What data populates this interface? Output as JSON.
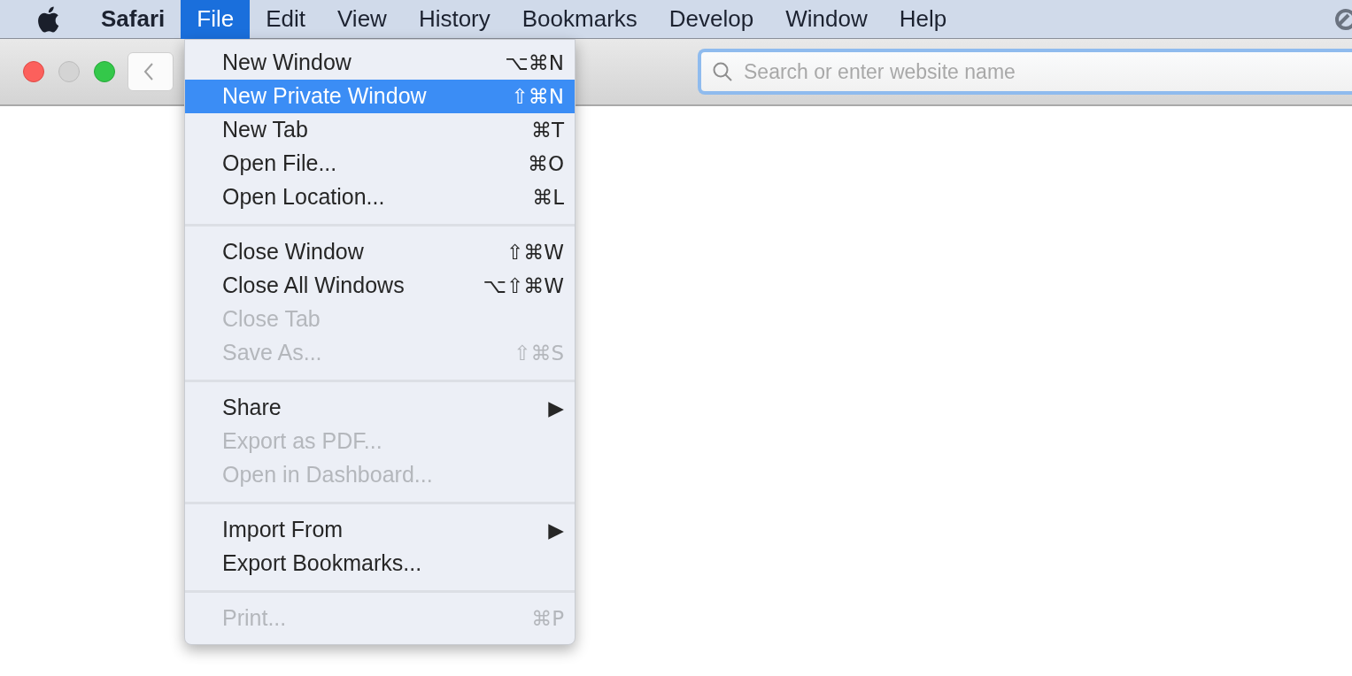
{
  "menu_bar": {
    "items": [
      {
        "label": "Safari",
        "kind": "app",
        "selected": false
      },
      {
        "label": "File",
        "kind": "menu",
        "selected": true
      },
      {
        "label": "Edit",
        "kind": "menu",
        "selected": false
      },
      {
        "label": "View",
        "kind": "menu",
        "selected": false
      },
      {
        "label": "History",
        "kind": "menu",
        "selected": false
      },
      {
        "label": "Bookmarks",
        "kind": "menu",
        "selected": false
      },
      {
        "label": "Develop",
        "kind": "menu",
        "selected": false
      },
      {
        "label": "Window",
        "kind": "menu",
        "selected": false
      },
      {
        "label": "Help",
        "kind": "menu",
        "selected": false
      }
    ]
  },
  "toolbar": {
    "search": {
      "placeholder": "Search or enter website name"
    }
  },
  "file_menu": {
    "items": [
      {
        "kind": "item",
        "label": "New Window",
        "shortcut": "⌥⌘N",
        "disabled": false,
        "selected": false
      },
      {
        "kind": "item",
        "label": "New Private Window",
        "shortcut": "⇧⌘N",
        "disabled": false,
        "selected": true
      },
      {
        "kind": "item",
        "label": "New Tab",
        "shortcut": "⌘T",
        "disabled": false,
        "selected": false
      },
      {
        "kind": "item",
        "label": "Open File...",
        "shortcut": "⌘O",
        "disabled": false,
        "selected": false
      },
      {
        "kind": "item",
        "label": "Open Location...",
        "shortcut": "⌘L",
        "disabled": false,
        "selected": false
      },
      {
        "kind": "separator"
      },
      {
        "kind": "item",
        "label": "Close Window",
        "shortcut": "⇧⌘W",
        "disabled": false,
        "selected": false
      },
      {
        "kind": "item",
        "label": "Close All Windows",
        "shortcut": "⌥⇧⌘W",
        "disabled": false,
        "selected": false
      },
      {
        "kind": "item",
        "label": "Close Tab",
        "disabled": true,
        "selected": false
      },
      {
        "kind": "item",
        "label": "Save As...",
        "shortcut": "⇧⌘S",
        "disabled": true,
        "selected": false
      },
      {
        "kind": "separator"
      },
      {
        "kind": "item",
        "label": "Share",
        "shortcut": "▶",
        "disabled": false,
        "selected": false
      },
      {
        "kind": "item",
        "label": "Export as PDF...",
        "disabled": true,
        "selected": false
      },
      {
        "kind": "item",
        "label": "Open in Dashboard...",
        "disabled": true,
        "selected": false
      },
      {
        "kind": "separator"
      },
      {
        "kind": "item",
        "label": "Import From",
        "shortcut": "▶",
        "disabled": false,
        "selected": false
      },
      {
        "kind": "item",
        "label": "Export Bookmarks...",
        "disabled": false,
        "selected": false
      },
      {
        "kind": "separator"
      },
      {
        "kind": "item",
        "label": "Print...",
        "shortcut": "⌘P",
        "disabled": true,
        "selected": false
      }
    ]
  }
}
